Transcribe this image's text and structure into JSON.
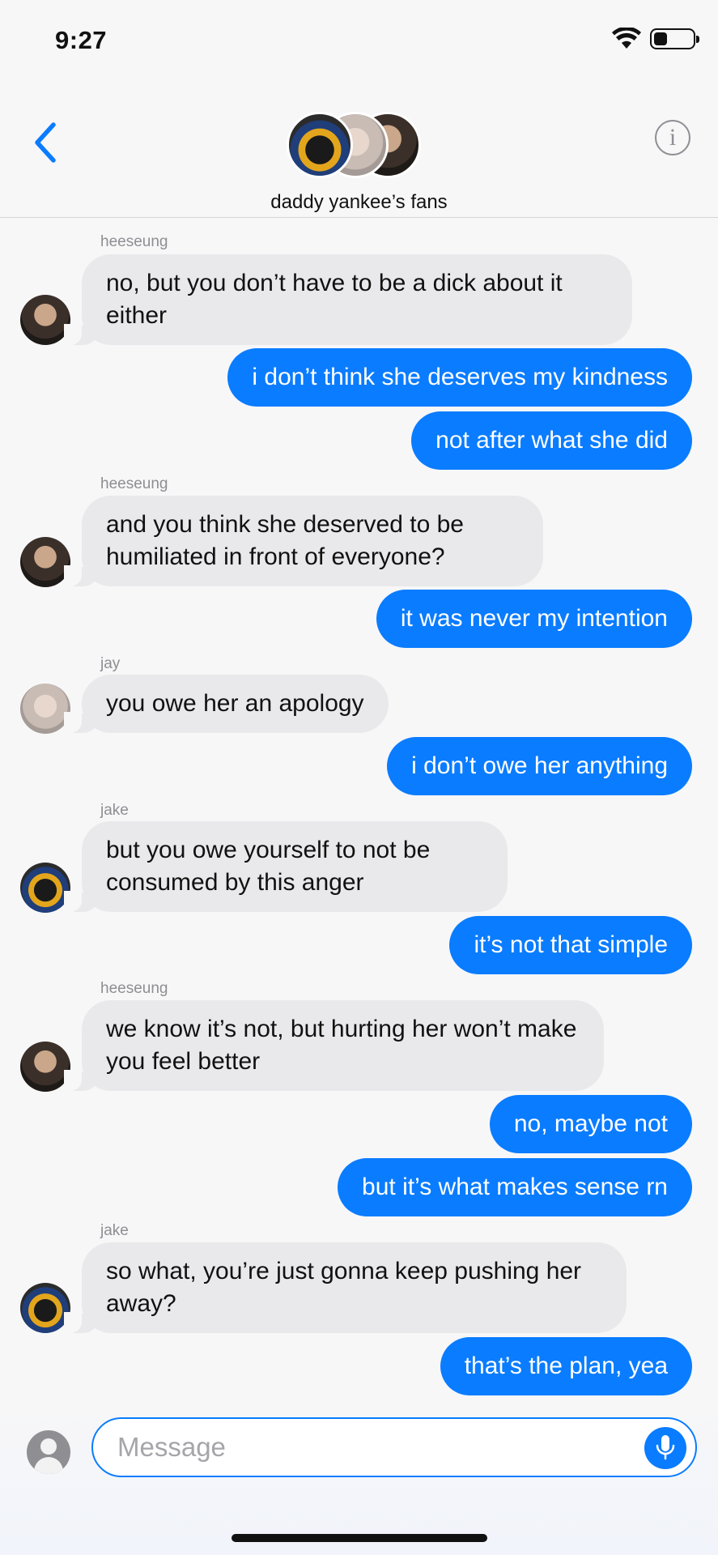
{
  "status_bar": {
    "time": "9:27",
    "battery_level": 0.35
  },
  "header": {
    "group_name": "daddy yankee’s fans",
    "back_icon": "chevron-left-icon",
    "info_icon": "info-icon",
    "info_glyph": "i"
  },
  "messages": [
    {
      "sender": "heeseung",
      "text": "no, but you don’t have to be a dick about it either"
    },
    {
      "text": "i don’t think she deserves my kindness"
    },
    {
      "text": "not after what she did"
    },
    {
      "sender": "heeseung",
      "text": "and you think she deserved to be humiliated in front of everyone?"
    },
    {
      "text": "it was never my intention"
    },
    {
      "sender": "jay",
      "text": "you owe her an apology"
    },
    {
      "text": "i don’t owe her anything"
    },
    {
      "sender": "jake",
      "text": "but you owe yourself to not be consumed by this anger"
    },
    {
      "text": "it’s not that simple"
    },
    {
      "sender": "heeseung",
      "text": "we know it’s not, but hurting her won’t make you feel better"
    },
    {
      "text": "no, maybe not"
    },
    {
      "text": "but it’s what makes sense rn"
    },
    {
      "sender": "jake",
      "text": "so what, you’re just gonna keep pushing her away?"
    },
    {
      "text": "that’s the plan, yea"
    }
  ],
  "composer": {
    "placeholder": "Message",
    "mic_icon": "microphone-icon"
  },
  "colors": {
    "accent": "#0a7cff",
    "incoming_bubble": "#e9e9eb",
    "background": "#f7f7f8"
  }
}
